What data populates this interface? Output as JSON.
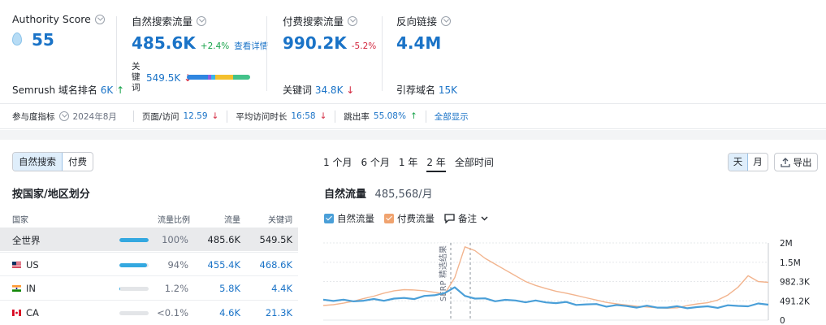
{
  "colors": {
    "accent": "#1a73c7",
    "organic": "#4a9fd8",
    "paid": "#f2b48e",
    "up": "#17a34a",
    "down": "#d3273e"
  },
  "authority": {
    "label": "Authority Score",
    "value": "55",
    "rank_label": "Semrush 域名排名",
    "rank_value": "6K",
    "rank_arrow": "↑"
  },
  "organic": {
    "label": "自然搜索流量",
    "value": "485.6K",
    "delta": "+2.4%",
    "detail_link": "查看详情",
    "kw_label_1": "关",
    "kw_label_2": "键",
    "kw_label_3": "词",
    "kw_value": "549.5K",
    "kw_arrow": "↓"
  },
  "paid": {
    "label": "付费搜索流量",
    "value": "990.2K",
    "delta": "-5.2%",
    "kw_label": "关键词",
    "kw_value": "34.8K",
    "kw_arrow": "↓"
  },
  "backlinks": {
    "label": "反向链接",
    "value": "4.4M",
    "ref_label": "引荐域名",
    "ref_value": "15K"
  },
  "engagement": {
    "label": "参与度指标",
    "date": "2024年8月",
    "pages_label": "页面/访问",
    "pages_value": "12.59",
    "pages_arrow": "↓",
    "duration_label": "平均访问时长",
    "duration_value": "16:58",
    "duration_arrow": "↓",
    "bounce_label": "跳出率",
    "bounce_value": "55.08%",
    "bounce_arrow": "↑",
    "show_all": "全部显示"
  },
  "left": {
    "tab_organic": "自然搜索",
    "tab_paid": "付费",
    "title": "按国家/地区划分",
    "headers": {
      "country": "国家",
      "share": "流量比例",
      "traffic": "流量",
      "keywords": "关键词"
    },
    "rows": [
      {
        "country": "全世界",
        "share": "100%",
        "share_frac": 1.0,
        "traffic": "485.6K",
        "keywords": "549.5K"
      },
      {
        "country": "US",
        "share": "94%",
        "share_frac": 0.94,
        "traffic": "455.4K",
        "keywords": "468.6K"
      },
      {
        "country": "IN",
        "share": "1.2%",
        "share_frac": 0.012,
        "traffic": "5.8K",
        "keywords": "4.4K"
      },
      {
        "country": "CA",
        "share": "<0.1%",
        "share_frac": 0.001,
        "traffic": "4.6K",
        "keywords": "21.3K"
      }
    ]
  },
  "right": {
    "ranges": [
      "1 个月",
      "6 个月",
      "1 年",
      "2 年",
      "全部时间"
    ],
    "active_range": "2 年",
    "day": "天",
    "month": "月",
    "export": "导出",
    "title": "自然流量",
    "title_value": "485,568/月",
    "legend_organic": "自然流量",
    "legend_paid": "付费流量",
    "notes": "备注"
  },
  "chart_data": {
    "type": "line",
    "y_ticks": [
      "2M",
      "1.5M",
      "982.3K",
      "491.2K",
      "0"
    ],
    "ylim": [
      0,
      2000000
    ],
    "annotation": "SERP 精选结果",
    "series": [
      {
        "name": "自然流量",
        "values": [
          530000,
          520000,
          500000,
          505000,
          510000,
          520000,
          530000,
          545000,
          560000,
          575000,
          600000,
          650000,
          720000,
          820000,
          650000,
          560000,
          540000,
          520000,
          510000,
          500000,
          490000,
          480000,
          470000,
          455000,
          440000,
          420000,
          405000,
          395000,
          380000,
          370000,
          360000,
          350000,
          345000,
          340000,
          335000,
          330000,
          335000,
          330000,
          340000,
          350000,
          360000,
          370000,
          380000,
          400000,
          420000
        ]
      },
      {
        "name": "付费流量",
        "values": [
          380000,
          400000,
          440000,
          490000,
          560000,
          620000,
          700000,
          760000,
          790000,
          780000,
          760000,
          720000,
          680000,
          1100000,
          1900000,
          1800000,
          1600000,
          1450000,
          1300000,
          1150000,
          1000000,
          900000,
          820000,
          750000,
          700000,
          640000,
          580000,
          520000,
          460000,
          420000,
          390000,
          360000,
          340000,
          320000,
          310000,
          320000,
          380000,
          420000,
          450000,
          520000,
          650000,
          850000,
          1150000,
          1000000,
          980000
        ]
      }
    ]
  }
}
